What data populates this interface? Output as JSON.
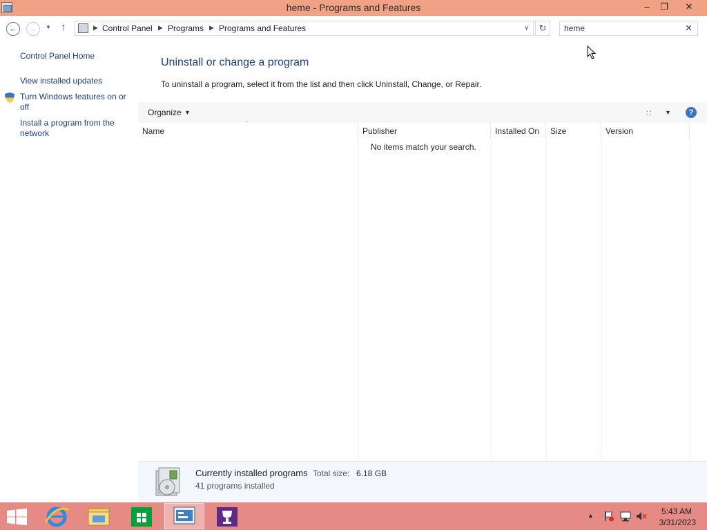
{
  "window": {
    "title": "heme - Programs and Features",
    "minimize_glyph": "–",
    "maximize_glyph": "❐",
    "close_glyph": "✕"
  },
  "navigation": {
    "back_glyph": "←",
    "forward_glyph": "→",
    "recent_glyph": "▼",
    "up_glyph": "↑",
    "breadcrumb": [
      "Control Panel",
      "Programs",
      "Programs and Features"
    ],
    "separator_glyph": "▶",
    "dropdown_glyph": "∨",
    "refresh_glyph": "↻",
    "search": {
      "value": "heme",
      "clear_glyph": "✕"
    }
  },
  "sidebar": {
    "items": [
      {
        "label": "Control Panel Home",
        "icon": null
      },
      {
        "label": "View installed updates",
        "icon": null
      },
      {
        "label": "Turn Windows features on or off",
        "icon": "uac-shield-icon"
      },
      {
        "label": "Install a program from the network",
        "icon": null
      }
    ]
  },
  "main": {
    "heading": "Uninstall or change a program",
    "instructions": "To uninstall a program, select it from the list and then click Uninstall, Change, or Repair.",
    "toolbar": {
      "organize_label": "Organize",
      "dropdown_glyph": "▼",
      "view_glyph": "∷",
      "help_glyph": "?"
    },
    "columns": [
      "Name",
      "Publisher",
      "Installed On",
      "Size",
      "Version"
    ],
    "sort_glyph": "ˆ",
    "empty_message": "No items match your search."
  },
  "details": {
    "title": "Currently installed programs",
    "total_size_label": "Total size:",
    "total_size_value": "6.18 GB",
    "count_text": "41 programs installed"
  },
  "taskbar": {
    "items": [
      {
        "name": "start-button",
        "icon": "windows-logo-icon"
      },
      {
        "name": "internet-explorer",
        "icon": "ie-icon"
      },
      {
        "name": "file-explorer",
        "icon": "folder-icon"
      },
      {
        "name": "store",
        "icon": "store-icon"
      },
      {
        "name": "control-panel",
        "icon": "control-panel-icon",
        "active": true
      },
      {
        "name": "trophy-app",
        "icon": "trophy-icon"
      }
    ],
    "tray_arrow_glyph": "▲",
    "clock": {
      "time": "5:43 AM",
      "date": "3/31/2023"
    }
  },
  "colors": {
    "titlebar": "#f1a184",
    "taskbar": "#e58a85",
    "link": "#1e3c78",
    "heading": "#1e3f7a",
    "toolbar": "#f5f6f7",
    "details_bg": "#f4f7fc"
  }
}
